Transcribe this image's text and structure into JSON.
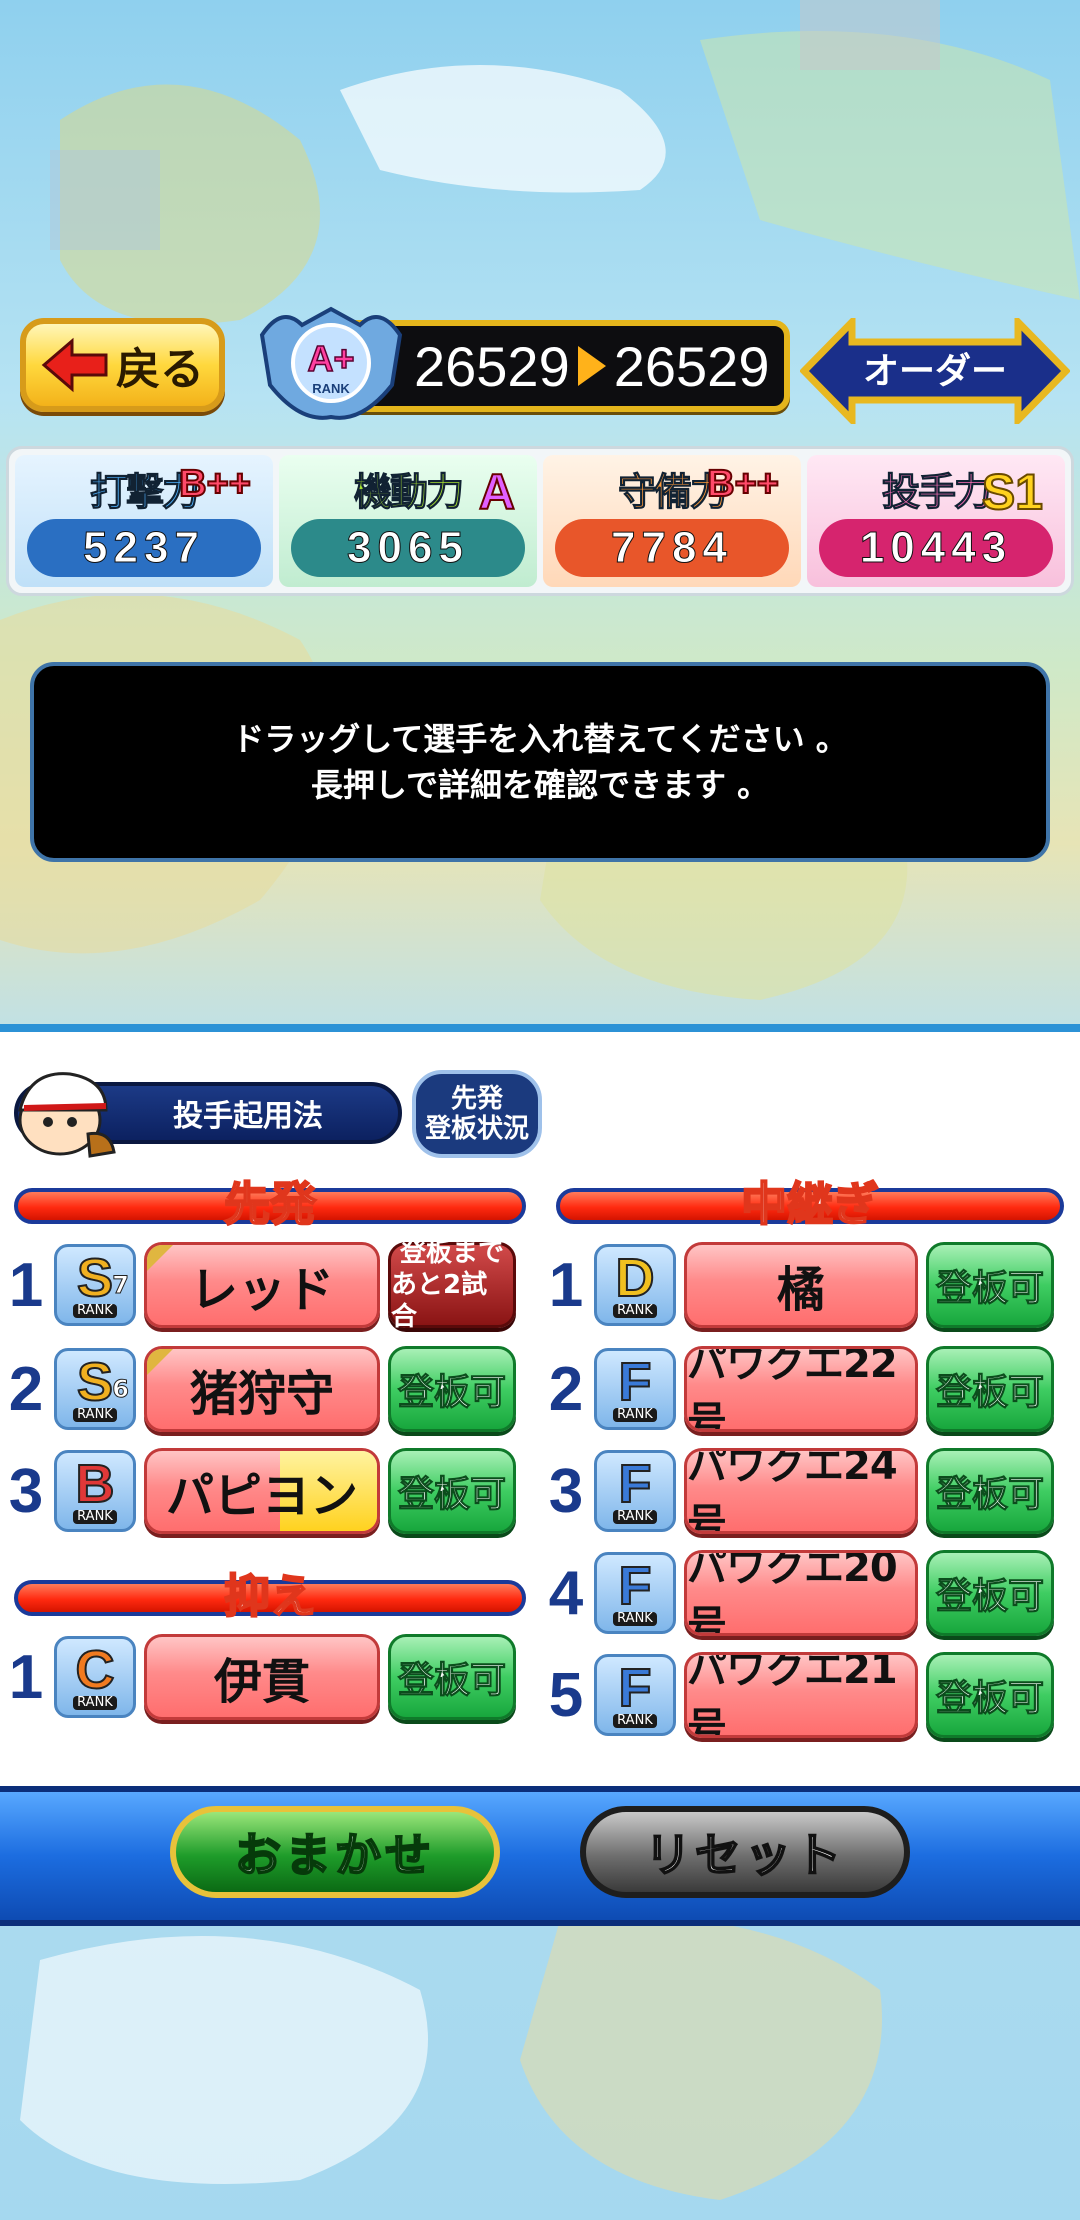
{
  "header": {
    "back_label": "戻る",
    "rank_label": "A+",
    "rank_word": "RANK",
    "score_before": "26529",
    "score_after": "26529",
    "order_label": "オーダー"
  },
  "stats": [
    {
      "label": "打撃力",
      "grade": "B++",
      "value": "5237",
      "color": "#2a6fc2"
    },
    {
      "label": "機動力",
      "grade": "A",
      "value": "3065",
      "color": "#2c8a8a"
    },
    {
      "label": "守備力",
      "grade": "B++",
      "value": "7784",
      "color": "#e8562a"
    },
    {
      "label": "投手力",
      "grade": "S1",
      "value": "10443",
      "color": "#d6246e"
    }
  ],
  "message": {
    "line1": "ドラッグして選手を入れ替えてください 。",
    "line2": "長押しで詳細を確認できます 。"
  },
  "panel": {
    "method_label": "投手起用法",
    "status_line1": "先発",
    "status_line2": "登板状況"
  },
  "sections": {
    "starter_title": "先発",
    "closer_title": "抑え",
    "relief_title": "中継ぎ"
  },
  "starters": [
    {
      "num": "1",
      "rank": "S",
      "rank_sub": "7",
      "name": "レッド",
      "status_top": "登板まで",
      "status_bottom": "あと2試合"
    },
    {
      "num": "2",
      "rank": "S",
      "rank_sub": "6",
      "name": "猪狩守",
      "status": "登板可"
    },
    {
      "num": "3",
      "rank": "B",
      "rank_sub": "",
      "name": "パピヨン",
      "status": "登板可"
    }
  ],
  "closers": [
    {
      "num": "1",
      "rank": "C",
      "rank_sub": "",
      "name": "伊貫",
      "status": "登板可"
    }
  ],
  "relievers": [
    {
      "num": "1",
      "rank": "D",
      "name": "橘",
      "status": "登板可"
    },
    {
      "num": "2",
      "rank": "F",
      "name": "パワクエ22号",
      "status": "登板可"
    },
    {
      "num": "3",
      "rank": "F",
      "name": "パワクエ24号",
      "status": "登板可"
    },
    {
      "num": "4",
      "rank": "F",
      "name": "パワクエ20号",
      "status": "登板可"
    },
    {
      "num": "5",
      "rank": "F",
      "name": "パワクエ21号",
      "status": "登板可"
    }
  ],
  "rank_word": "RANK",
  "footer": {
    "auto_label": "おまかせ",
    "reset_label": "リセット"
  },
  "colors": {
    "rank_S": "#f0b020",
    "rank_B": "#e03838",
    "rank_C": "#f07a20",
    "rank_D": "#f0c020",
    "rank_F": "#3a7ad8"
  }
}
